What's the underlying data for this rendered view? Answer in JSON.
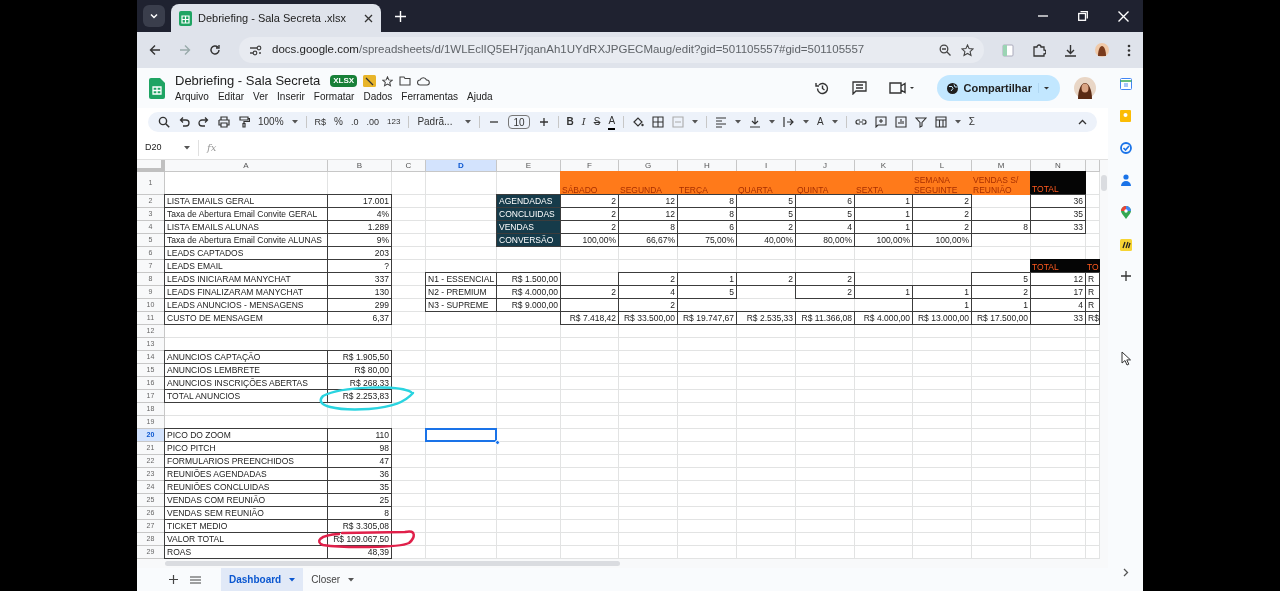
{
  "browser": {
    "tab_title": "Debriefing - Sala Secreta .xlsx",
    "url_host": "docs.google.com",
    "url_path": "/spreadsheets/d/1WLEclIQ5EH7jqanAh1UYdRXJPGECMaug/edit?gid=501105557#gid=501105557"
  },
  "document": {
    "title": "Debriefing - Sala Secreta",
    "badge": "XLSX",
    "menus": [
      "Arquivo",
      "Editar",
      "Ver",
      "Inserir",
      "Formatar",
      "Dados",
      "Ferramentas",
      "Ajuda"
    ],
    "share_button": "Compartilhar"
  },
  "toolbar": {
    "zoom": "100%",
    "currency": "R$",
    "percent": "%",
    "decrease_decimals": ".0",
    "increase_decimals": ".00",
    "number_format": "123",
    "font": "Padrã...",
    "font_size": "10",
    "bold": "B",
    "italic": "I",
    "strikethrough": "S",
    "text_color": "A",
    "text_color_2": "A",
    "sum": "Σ"
  },
  "name_box": "D20",
  "formula_label": "fx",
  "columns": [
    {
      "letter": "A",
      "selected": false
    },
    {
      "letter": "B",
      "selected": false
    },
    {
      "letter": "C",
      "selected": false
    },
    {
      "letter": "D",
      "selected": true
    },
    {
      "letter": "E",
      "selected": false
    },
    {
      "letter": "F",
      "selected": false
    },
    {
      "letter": "G",
      "selected": false
    },
    {
      "letter": "H",
      "selected": false
    },
    {
      "letter": "I",
      "selected": false
    },
    {
      "letter": "J",
      "selected": false
    },
    {
      "letter": "K",
      "selected": false
    },
    {
      "letter": "L",
      "selected": false
    },
    {
      "letter": "M",
      "selected": false
    },
    {
      "letter": "N",
      "selected": false
    },
    {
      "selected": false
    }
  ],
  "row_headers": [
    {
      "number": "1",
      "selected": false
    },
    {
      "number": "2",
      "selected": false
    },
    {
      "number": "3",
      "selected": false
    },
    {
      "number": "4",
      "selected": false
    },
    {
      "number": "5",
      "selected": false
    },
    {
      "number": "6",
      "selected": false
    },
    {
      "number": "7",
      "selected": false
    },
    {
      "number": "8",
      "selected": false
    },
    {
      "number": "9",
      "selected": false
    },
    {
      "number": "10",
      "selected": false
    },
    {
      "number": "11",
      "selected": false
    },
    {
      "number": "12",
      "selected": false
    },
    {
      "number": "13",
      "selected": false
    },
    {
      "number": "14",
      "selected": false
    },
    {
      "number": "15",
      "selected": false
    },
    {
      "number": "16",
      "selected": false
    },
    {
      "number": "17",
      "selected": false
    },
    {
      "number": "18",
      "selected": false
    },
    {
      "number": "19",
      "selected": false
    },
    {
      "number": "20",
      "selected": true
    },
    {
      "number": "21",
      "selected": false
    },
    {
      "number": "22",
      "selected": false
    },
    {
      "number": "23",
      "selected": false
    },
    {
      "number": "24",
      "selected": false
    },
    {
      "number": "25",
      "selected": false
    },
    {
      "number": "26",
      "selected": false
    },
    {
      "number": "27",
      "selected": false
    },
    {
      "number": "28",
      "selected": false
    },
    {
      "number": "29",
      "selected": false
    }
  ],
  "tables": [
    {
      "kind": "weekly",
      "header": [
        "SÁBADO",
        "SEGUNDA",
        "TERÇA",
        "QUARTA",
        "QUINTA",
        "SEXTA",
        "SEMANA SEGUINTE",
        "VENDAS S/ REUNIÃO",
        "TOTAL"
      ],
      "rows": [
        [
          "AGENDADAS",
          "2",
          "12",
          "8",
          "5",
          "6",
          "1",
          "2",
          null,
          "36"
        ],
        [
          "CONCLUIDAS",
          "2",
          "12",
          "8",
          "5",
          "5",
          "1",
          "2",
          null,
          "35"
        ],
        [
          "VENDAS",
          "2",
          "8",
          "6",
          "2",
          "4",
          "1",
          "2",
          "8",
          "33"
        ],
        [
          "CONVERSÃO",
          "100,00%",
          "66,67%",
          "75,00%",
          "40,00%",
          "80,00%",
          "100,00%",
          "100,00%",
          null,
          null
        ]
      ]
    },
    {
      "kind": "metrics",
      "rows": [
        [
          "LISTA EMAILS GERAL",
          "17.001"
        ],
        [
          "Taxa de Abertura Email Convite GERAL",
          "4%"
        ],
        [
          "LISTA EMAILS ALUNAS",
          "1.289"
        ],
        [
          "Taxa de Abertura Email Convite ALUNAS",
          "9%"
        ],
        [
          "LEADS CAPTADOS",
          "203"
        ],
        [
          "LEADS EMAIL",
          "?"
        ],
        [
          "LEADS INICIARAM MANYCHAT",
          "337"
        ],
        [
          "LEADS FINALIZARAM MANYCHAT",
          "130"
        ],
        [
          "LEADS ANUNCIOS - MENSAGENS",
          "299"
        ],
        [
          "CUSTO DE MENSAGEM",
          "6,37"
        ]
      ]
    },
    {
      "kind": "plans",
      "header": [
        "TOTAL",
        "TO"
      ],
      "rows": [
        [
          "N1 - ESSENCIAL",
          "R$ 1.500,00",
          null,
          "2",
          "1",
          "2",
          "2",
          null,
          null,
          "5",
          "12",
          "R"
        ],
        [
          "N2 - PREMIUM",
          "R$ 4.000,00",
          "2",
          "4",
          "5",
          null,
          "2",
          "1",
          "1",
          "2",
          "17",
          "R"
        ],
        [
          "N3 - SUPREME",
          "R$ 9.000,00",
          null,
          "2",
          null,
          null,
          null,
          null,
          "1",
          "1",
          "4",
          "R"
        ],
        [
          null,
          null,
          "R$ 7.418,42",
          "R$ 33.500,00",
          "R$ 19.747,67",
          "R$ 2.535,33",
          "R$ 11.366,08",
          "R$ 4.000,00",
          "R$ 13.000,00",
          "R$ 17.500,00",
          "33",
          "R$"
        ]
      ]
    },
    {
      "kind": "ads",
      "rows": [
        [
          "ANUNCIOS CAPTAÇÃO",
          "R$ 1.905,50"
        ],
        [
          "ANUNCIOS LEMBRETE",
          "R$ 80,00"
        ],
        [
          "ANUNCIOS INSCRIÇÕES ABERTAS",
          "R$ 268,33"
        ],
        [
          "TOTAL ANUNCIOS",
          "R$ 2.253,83"
        ]
      ]
    },
    {
      "kind": "funnel",
      "rows": [
        [
          "PICO DO ZOOM",
          "110"
        ],
        [
          "PICO PITCH",
          "98"
        ],
        [
          "FORMULARIOS PREENCHIDOS",
          "47"
        ],
        [
          "REUNIÕES AGENDADAS",
          "36"
        ],
        [
          "REUNIÕES CONCLUIDAS",
          "35"
        ],
        [
          "VENDAS COM REUNIÃO",
          "25"
        ],
        [
          "VENDAS SEM REUNIÃO",
          "8"
        ],
        [
          "TICKET MEDIO",
          "R$ 3.305,08"
        ],
        [
          "VALOR TOTAL",
          "R$ 109.067,50"
        ],
        [
          "ROAS",
          "48,39"
        ]
      ]
    }
  ],
  "annotations": [
    {
      "kind": "ellipse",
      "color": "#2ad4e0"
    },
    {
      "kind": "loop",
      "color": "#e0204a"
    }
  ],
  "sheet_tabs": [
    {
      "label": "Dashboard",
      "selected": true
    },
    {
      "label": "Closer",
      "selected": false
    }
  ]
}
